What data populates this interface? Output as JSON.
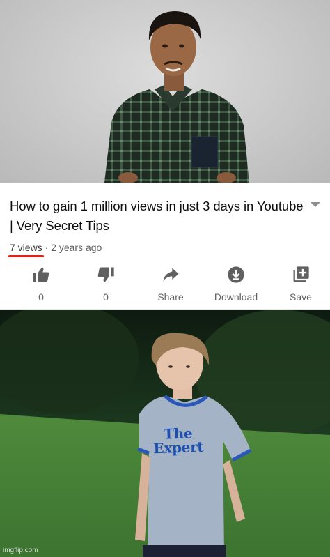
{
  "video": {
    "title": "How to gain 1 million views in just 3 days in Youtube | Very Secret Tips",
    "views": "7 views",
    "separator": " · ",
    "age": "2 years ago"
  },
  "actions": [
    {
      "icon": "thumbs-up-icon",
      "label": "0"
    },
    {
      "icon": "thumbs-down-icon",
      "label": "0"
    },
    {
      "icon": "share-icon",
      "label": "Share"
    },
    {
      "icon": "download-icon",
      "label": "Download"
    },
    {
      "icon": "save-playlist-icon",
      "label": "Save"
    }
  ],
  "shirt": {
    "line1": "The",
    "line2": "Expert"
  },
  "watermark": "imgflip.com",
  "colors": {
    "underline": "#e0231a",
    "icon": "#606060",
    "shirt_text": "#1c4fae"
  }
}
